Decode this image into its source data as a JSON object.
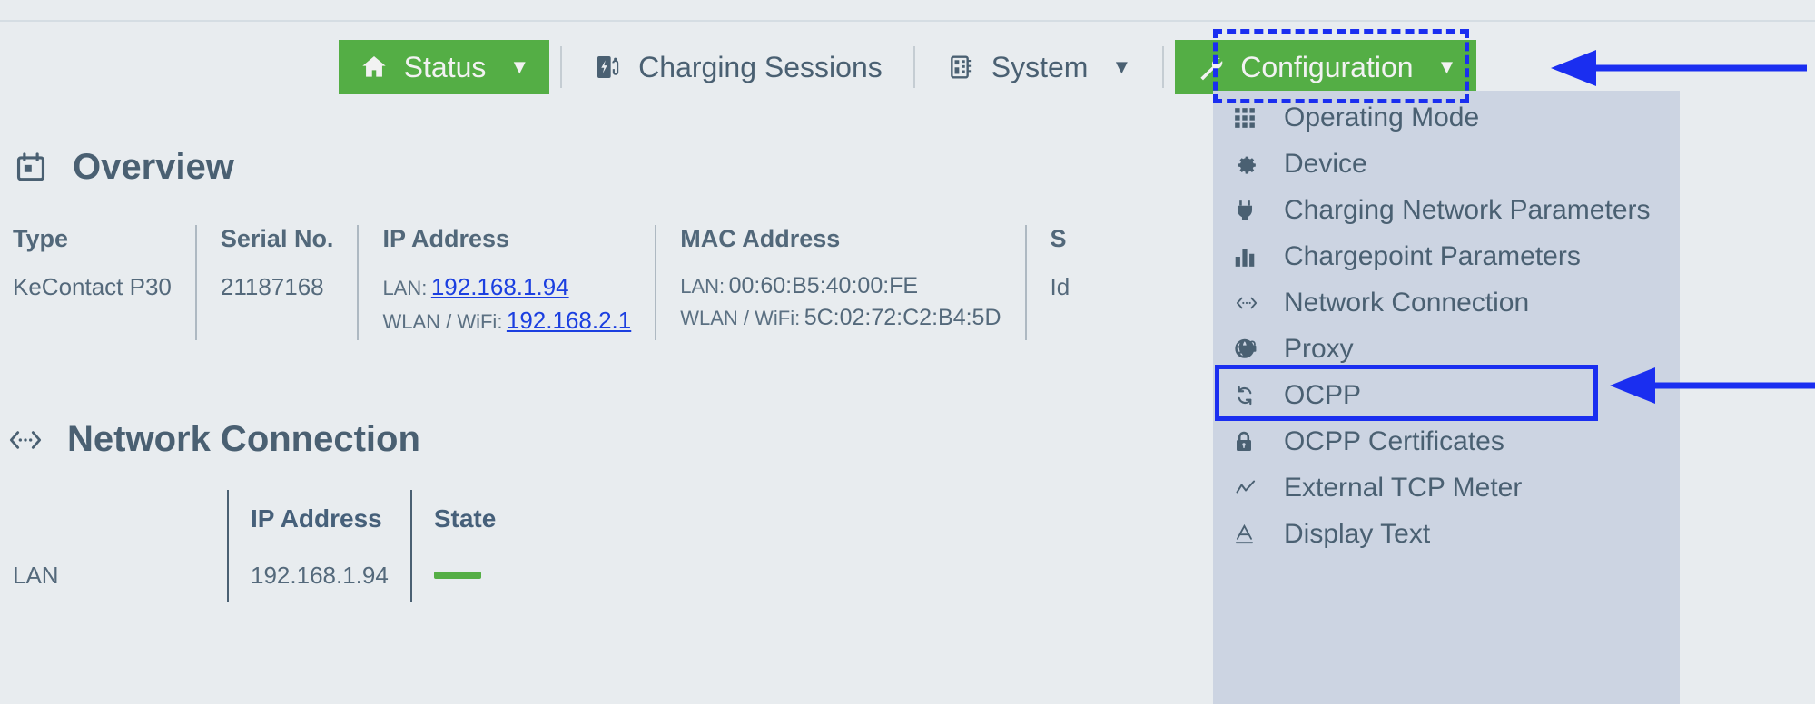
{
  "nav": {
    "items": [
      {
        "label": "Status",
        "icon": "home-icon",
        "caret": "▼",
        "active": true
      },
      {
        "label": "Charging Sessions",
        "icon": "charging-station-icon",
        "caret": "",
        "active": false
      },
      {
        "label": "System",
        "icon": "chip-icon",
        "caret": "▼",
        "active": false
      },
      {
        "label": "Configuration",
        "icon": "wrench-icon",
        "caret": "▼",
        "active": true
      }
    ]
  },
  "dropdown": {
    "items": [
      {
        "label": "Operating Mode",
        "icon": "grid-icon"
      },
      {
        "label": "Device",
        "icon": "gear-icon"
      },
      {
        "label": "Charging Network Parameters",
        "icon": "plug-icon"
      },
      {
        "label": "Chargepoint Parameters",
        "icon": "bar-chart-icon"
      },
      {
        "label": "Network Connection",
        "icon": "network-connection-icon"
      },
      {
        "label": "Proxy",
        "icon": "globe-lock-icon"
      },
      {
        "label": "OCPP",
        "icon": "refresh-icon"
      },
      {
        "label": "OCPP Certificates",
        "icon": "lock-icon"
      },
      {
        "label": "External TCP Meter",
        "icon": "line-chart-icon"
      },
      {
        "label": "Display Text",
        "icon": "text-underline-icon"
      }
    ]
  },
  "overview": {
    "title": "Overview",
    "icon": "calendar-icon",
    "columns": [
      {
        "header": "Type",
        "value": "KeContact P30"
      },
      {
        "header": "Serial No.",
        "value": "21187168"
      },
      {
        "header": "IP Address",
        "lan_key": "LAN:",
        "lan_value": "192.168.1.94",
        "wlan_key": "WLAN / WiFi:",
        "wlan_value": "192.168.2.1"
      },
      {
        "header": "MAC Address",
        "lan_key": "LAN:",
        "lan_value": "00:60:B5:40:00:FE",
        "wlan_key": "WLAN / WiFi:",
        "wlan_value": "5C:02:72:C2:B4:5D"
      },
      {
        "header": "S",
        "value": "Id"
      }
    ]
  },
  "network_connection": {
    "title": "Network Connection",
    "icon": "network-connection-icon",
    "headers": [
      "",
      "IP Address",
      "State"
    ],
    "rows": [
      {
        "name": "LAN",
        "ip": "192.168.1.94",
        "state": ""
      }
    ]
  },
  "annotations": {
    "config_highlight": "dashed-blue-box",
    "network_highlight": "solid-blue-box",
    "arrow_color": "#1a2ef0"
  },
  "colors": {
    "page_bg": "#e8ecef",
    "accent_green": "#54ae45",
    "dropdown_bg": "#ccd4e2",
    "text": "#4a6072",
    "link": "#1b3fe0",
    "annotation": "#1a2ef0"
  }
}
